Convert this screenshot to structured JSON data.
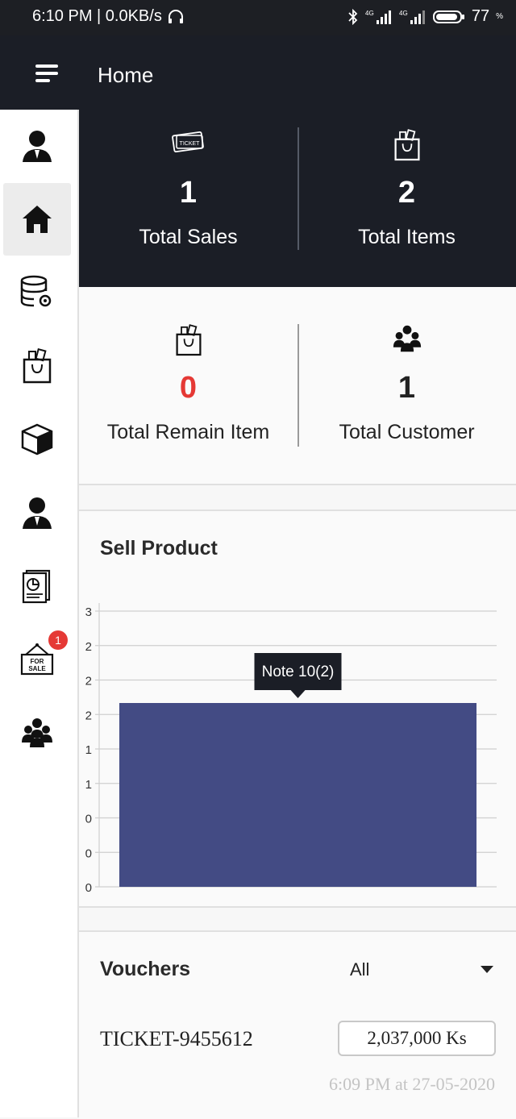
{
  "status_bar": {
    "time": "6:10 PM | 0.0KB/s",
    "battery": "77"
  },
  "appbar": {
    "title": "Home"
  },
  "sidebar": {
    "items": [
      {
        "icon": "user-avatar-icon"
      },
      {
        "icon": "home-icon"
      },
      {
        "icon": "database-settings-icon"
      },
      {
        "icon": "shopping-bag-icon"
      },
      {
        "icon": "box-icon"
      },
      {
        "icon": "user-icon"
      },
      {
        "icon": "report-icon"
      },
      {
        "icon": "for-sale-sign-icon"
      },
      {
        "icon": "customers-icon"
      }
    ],
    "badge": "1"
  },
  "stats": {
    "total_sales": {
      "value": "1",
      "label": "Total Sales"
    },
    "total_items": {
      "value": "2",
      "label": "Total Items"
    },
    "total_remain": {
      "value": "0",
      "label": "Total Remain Item"
    },
    "total_customer": {
      "value": "1",
      "label": "Total Customer"
    }
  },
  "sell_product": {
    "title": "Sell Product",
    "tooltip": "Note 10(2)"
  },
  "chart_data": {
    "type": "bar",
    "categories": [
      "Note 10"
    ],
    "series": [
      {
        "values": [
          2
        ]
      }
    ],
    "ylim": [
      0,
      3
    ],
    "y_tick_labels": [
      "3",
      "2",
      "2",
      "2",
      "1",
      "1",
      "0",
      "0",
      "0"
    ],
    "color": "#434b84",
    "grid": true
  },
  "vouchers": {
    "title": "Vouchers",
    "filter": "All",
    "items": [
      {
        "ticket": "TICKET-9455612",
        "amount": "2,037,000 Ks",
        "timestamp": "6:09 PM at 27-05-2020"
      }
    ]
  }
}
